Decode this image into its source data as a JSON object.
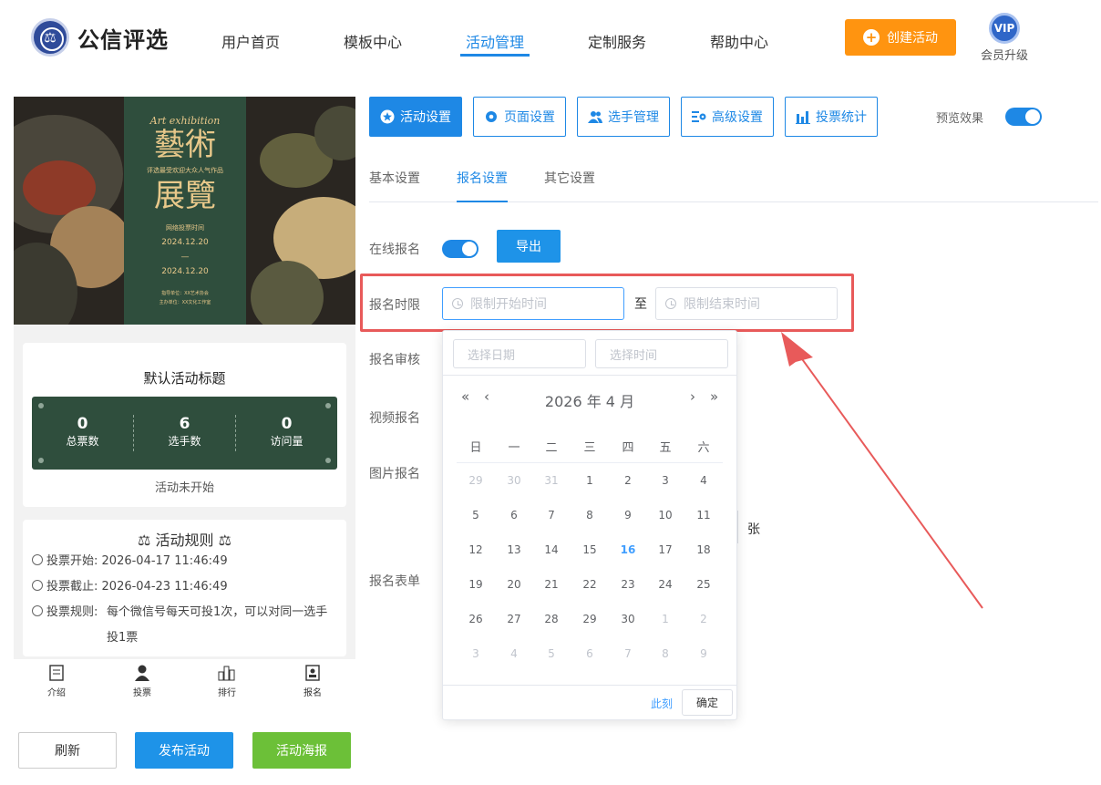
{
  "header": {
    "brand": "公信评选",
    "logo_mark": "⚖",
    "nav": [
      "用户首页",
      "模板中心",
      "活动管理",
      "定制服务",
      "帮助中心"
    ],
    "create_button": "创建活动",
    "vip_badge": "VIP",
    "vip_label": "会员升级"
  },
  "preview": {
    "poster": {
      "art_line": "Art exhibition",
      "title_1": "藝術",
      "title_2": "展覽",
      "subtitle": "评选最受欢迎大众人气作品",
      "vote_time_label": "网络投票时间",
      "date_start": "2024.12.20",
      "date_sep": "—",
      "date_end": "2024.12.20",
      "footer_1": "指导单位：XX艺术协会",
      "footer_2": "主办单位：XX文化工作室"
    },
    "activity_title": "默认活动标题",
    "stats": [
      {
        "value": "0",
        "label": "总票数"
      },
      {
        "value": "6",
        "label": "选手数"
      },
      {
        "value": "0",
        "label": "访问量"
      }
    ],
    "status": "活动未开始",
    "rules": {
      "title": "活动规则",
      "start_label": "投票开始:",
      "start_value": "2026-04-17 11:46:49",
      "end_label": "投票截止:",
      "end_value": "2026-04-23 11:46:49",
      "rule_label": "投票规则:",
      "rule_value": "每个微信号每天可投1次，可以对同一选手投1票"
    },
    "tabs": [
      "介绍",
      "投票",
      "排行",
      "报名"
    ]
  },
  "bottom_buttons": {
    "refresh": "刷新",
    "publish": "发布活动",
    "poster": "活动海报"
  },
  "settings_tabs": [
    "活动设置",
    "页面设置",
    "选手管理",
    "高级设置",
    "投票统计"
  ],
  "preview_toggle_label": "预览效果",
  "sub_tabs": [
    "基本设置",
    "报名设置",
    "其它设置"
  ],
  "form": {
    "online_signup": "在线报名",
    "export": "导出",
    "signup_time": "报名时限",
    "start_placeholder": "限制开始时间",
    "to": "至",
    "end_placeholder": "限制结束时间",
    "review": "报名审核",
    "video": "视频报名",
    "image": "图片报名",
    "unit": "张",
    "form_fields": "报名表单"
  },
  "picker": {
    "date_placeholder": "选择日期",
    "time_placeholder": "选择时间",
    "prev_year": "«",
    "prev_month": "‹",
    "next_month": "›",
    "next_year": "»",
    "year_month": "2026 年  4 月",
    "weekdays": [
      "日",
      "一",
      "二",
      "三",
      "四",
      "五",
      "六"
    ],
    "weeks": [
      [
        {
          "d": "29",
          "o": true
        },
        {
          "d": "30",
          "o": true
        },
        {
          "d": "31",
          "o": true
        },
        {
          "d": "1"
        },
        {
          "d": "2"
        },
        {
          "d": "3"
        },
        {
          "d": "4"
        }
      ],
      [
        {
          "d": "5"
        },
        {
          "d": "6"
        },
        {
          "d": "7"
        },
        {
          "d": "8"
        },
        {
          "d": "9"
        },
        {
          "d": "10"
        },
        {
          "d": "11"
        }
      ],
      [
        {
          "d": "12"
        },
        {
          "d": "13"
        },
        {
          "d": "14"
        },
        {
          "d": "15"
        },
        {
          "d": "16",
          "t": true
        },
        {
          "d": "17"
        },
        {
          "d": "18"
        }
      ],
      [
        {
          "d": "19"
        },
        {
          "d": "20"
        },
        {
          "d": "21"
        },
        {
          "d": "22"
        },
        {
          "d": "23"
        },
        {
          "d": "24"
        },
        {
          "d": "25"
        }
      ],
      [
        {
          "d": "26"
        },
        {
          "d": "27"
        },
        {
          "d": "28"
        },
        {
          "d": "29"
        },
        {
          "d": "30"
        },
        {
          "d": "1",
          "o": true
        },
        {
          "d": "2",
          "o": true
        }
      ],
      [
        {
          "d": "3",
          "o": true
        },
        {
          "d": "4",
          "o": true
        },
        {
          "d": "5",
          "o": true
        },
        {
          "d": "6",
          "o": true
        },
        {
          "d": "7",
          "o": true
        },
        {
          "d": "8",
          "o": true
        },
        {
          "d": "9",
          "o": true
        }
      ]
    ],
    "now": "此刻",
    "confirm": "确定"
  },
  "colors": {
    "primary": "#1e88e5",
    "accent_orange": "#ff9410",
    "green": "#6cc038",
    "highlight_red": "#e85a5a",
    "poster_green": "#2f4e3d"
  }
}
